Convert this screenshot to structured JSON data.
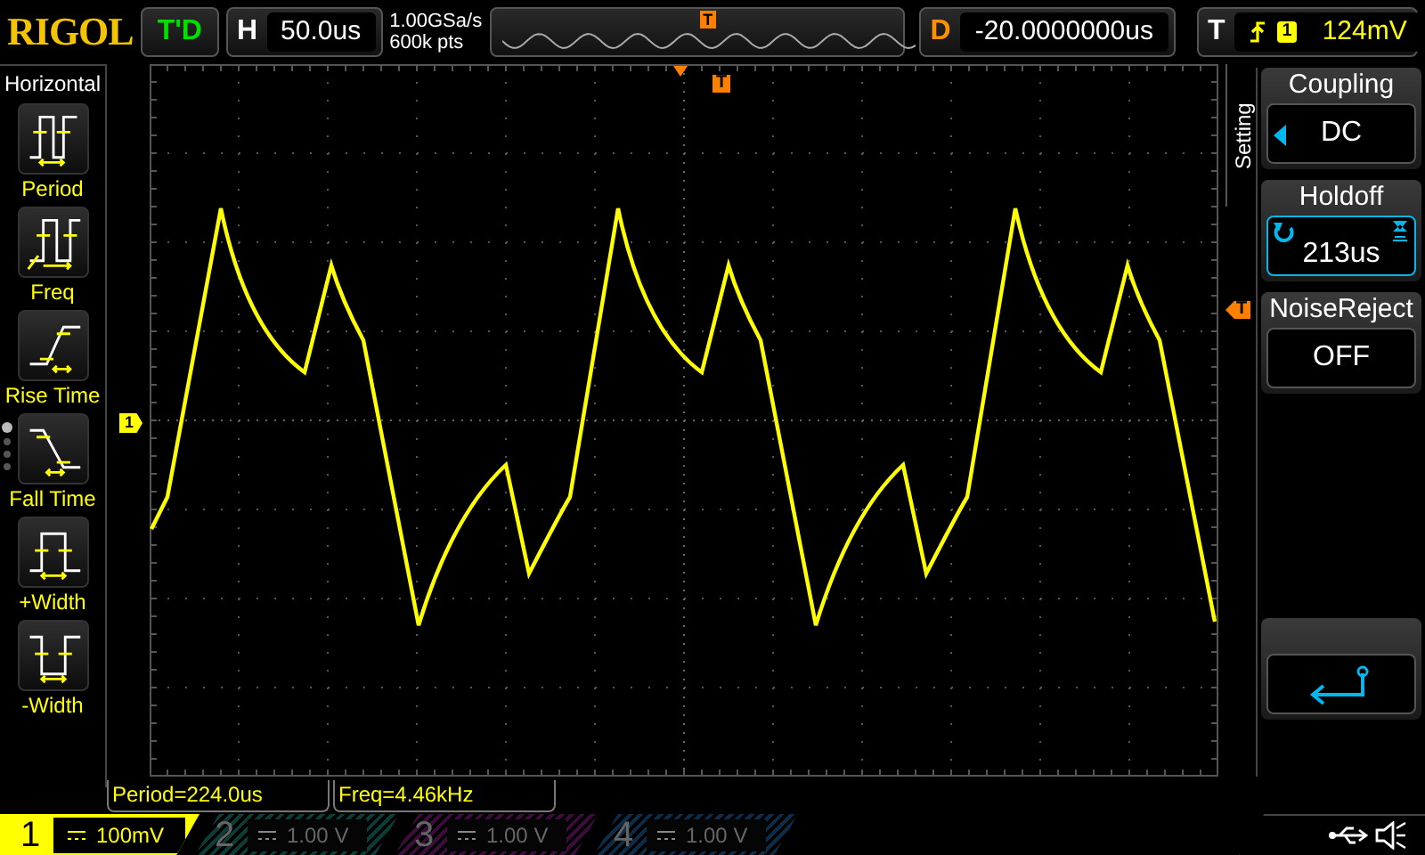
{
  "brand": "RIGOL",
  "status": "T'D",
  "horizontal": {
    "label": "H",
    "timebase": "50.0us"
  },
  "acquisition": {
    "sample_rate": "1.00GSa/s",
    "memory_depth": "600k pts"
  },
  "memory_marker": "T",
  "delay": {
    "label": "D",
    "value": "-20.0000000us"
  },
  "trigger": {
    "label": "T",
    "source": "1",
    "level": "124mV"
  },
  "sidebar": {
    "title": "Horizontal",
    "items": [
      {
        "label": "Period",
        "kind": "period"
      },
      {
        "label": "Freq",
        "kind": "freq"
      },
      {
        "label": "Rise Time",
        "kind": "rise"
      },
      {
        "label": "Fall Time",
        "kind": "fall"
      },
      {
        "label": "+Width",
        "kind": "pwidth"
      },
      {
        "label": "-Width",
        "kind": "nwidth"
      }
    ],
    "page_dots": [
      {
        "selected": true
      },
      {
        "selected": false
      },
      {
        "selected": false
      },
      {
        "selected": false
      }
    ]
  },
  "waveform": {
    "trigger_position_marker": "T",
    "trigger_level_marker": "T",
    "channel_marker": "1"
  },
  "menu": {
    "tab": "Setting",
    "items": [
      {
        "kind": "choice",
        "title": "Coupling",
        "value": "DC",
        "selected": false
      },
      {
        "kind": "knob",
        "title": "Holdoff",
        "value": "213us",
        "selected": true
      },
      {
        "kind": "plain",
        "title": "NoiseReject",
        "value": "OFF",
        "selected": false
      },
      {
        "kind": "back",
        "selected": false
      }
    ]
  },
  "measurements": [
    "Period=224.0us",
    "Freq=4.46kHz"
  ],
  "channels": [
    {
      "number": "1",
      "scale": "100mV",
      "on": true,
      "color": "#ffff00"
    },
    {
      "number": "2",
      "scale": "1.00 V",
      "on": false,
      "color": "#0c3c36"
    },
    {
      "number": "3",
      "scale": "1.00 V",
      "on": false,
      "color": "#3c0c3c"
    },
    {
      "number": "4",
      "scale": "1.00 V",
      "on": false,
      "color": "#0c2c48"
    }
  ]
}
